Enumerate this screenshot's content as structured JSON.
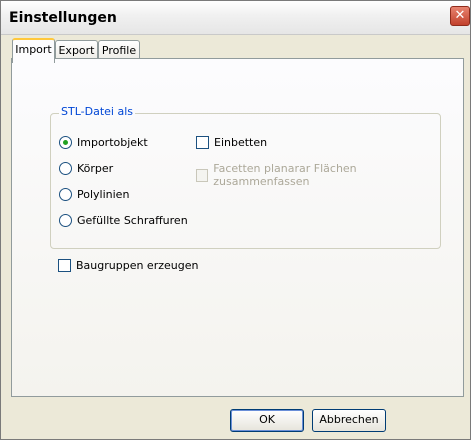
{
  "window": {
    "title": "Einstellungen",
    "close_symbol": "✕"
  },
  "tabs": [
    {
      "label": "Import",
      "active": true
    },
    {
      "label": "Export",
      "active": false
    },
    {
      "label": "Profile",
      "active": false
    }
  ],
  "stl_group": {
    "title": "STL-Datei als",
    "radio_options": [
      {
        "label": "Importobjekt",
        "selected": true
      },
      {
        "label": "Körper",
        "selected": false
      },
      {
        "label": "Polylinien",
        "selected": false
      },
      {
        "label": "Gefüllte Schraffuren",
        "selected": false
      }
    ],
    "checkboxes": [
      {
        "label": "Einbetten",
        "checked": false,
        "enabled": true
      },
      {
        "label": "Facetten planarar Flächen zusammenfassen",
        "checked": false,
        "enabled": false
      }
    ]
  },
  "assemblies_checkbox": {
    "label": "Baugruppen erzeugen",
    "checked": false
  },
  "buttons": {
    "ok": "OK",
    "cancel": "Abbrechen"
  },
  "colors": {
    "group_title": "#0046d5",
    "close_button": "#c2412c",
    "active_tab_accent": "#ffc83c"
  }
}
